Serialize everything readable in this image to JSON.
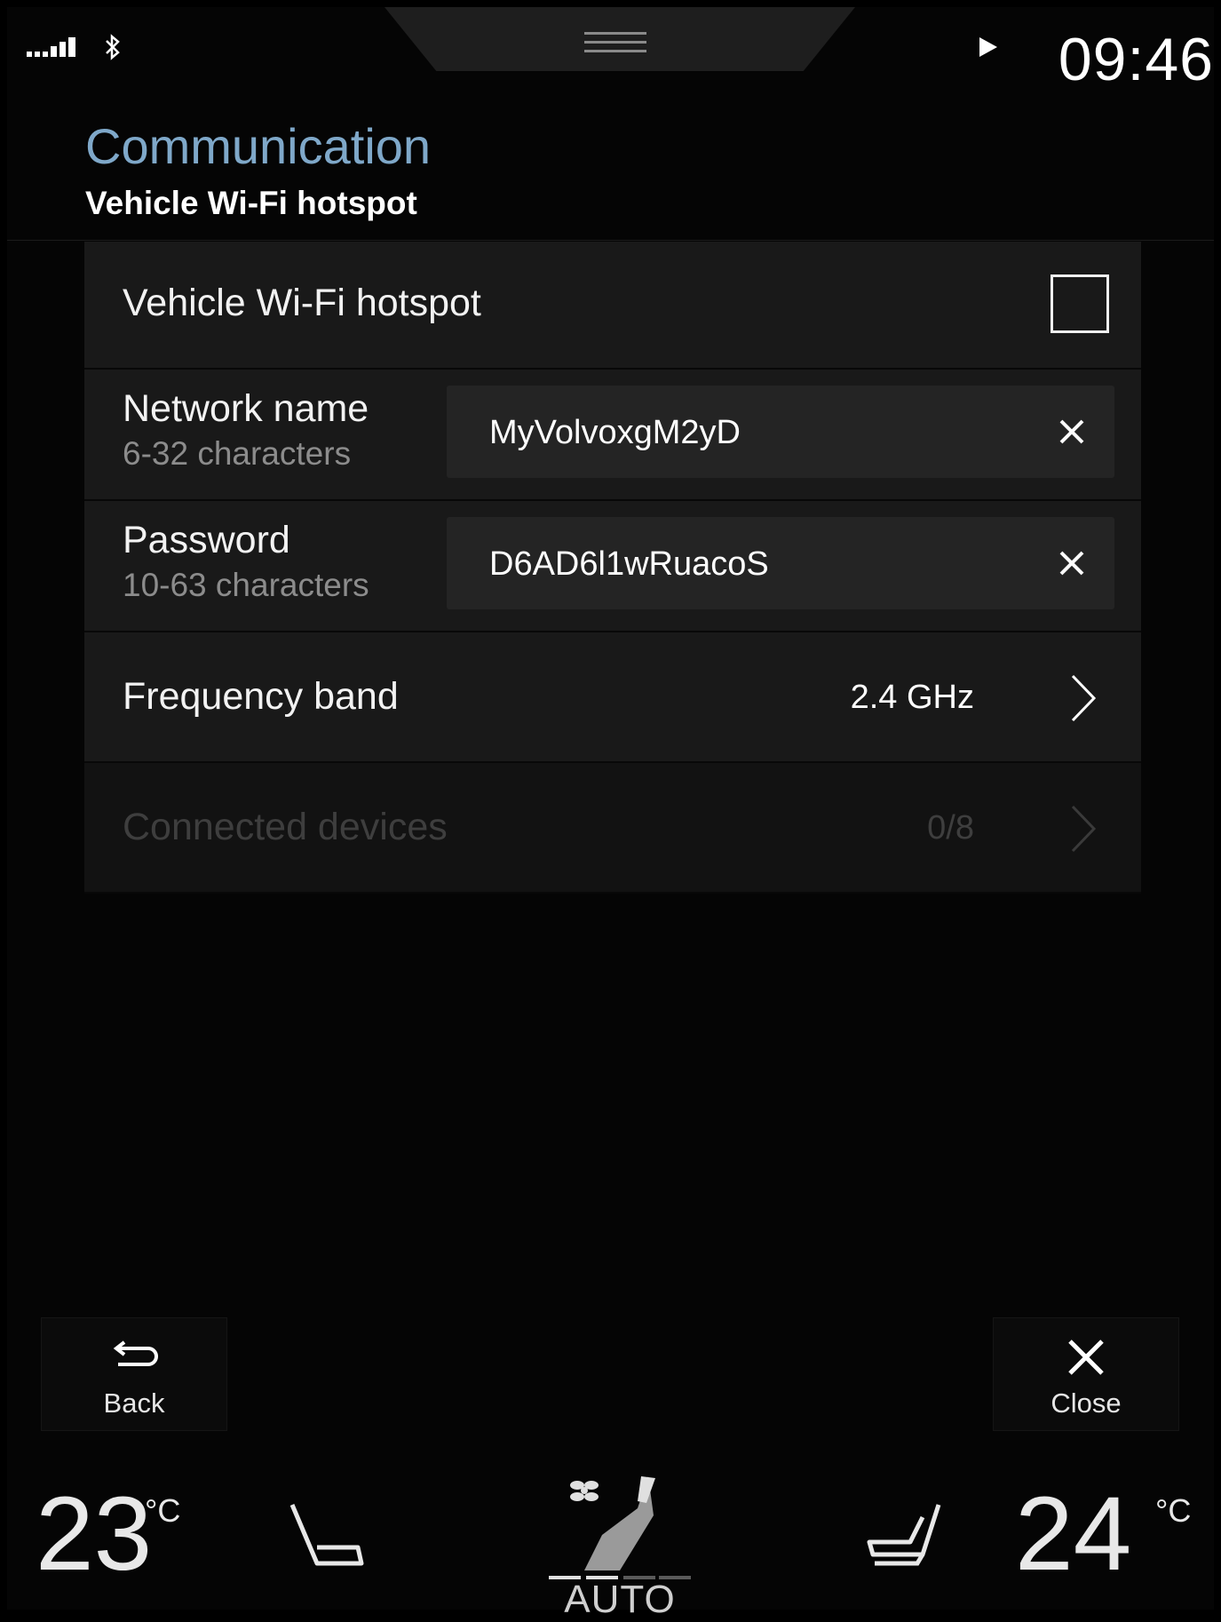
{
  "status_bar": {
    "signal_icon": "signal-strength-icon",
    "bluetooth_icon": "bluetooth-icon",
    "media_icon": "play-icon",
    "time": "09:46"
  },
  "header": {
    "title": "Communication",
    "subtitle": "Vehicle Wi-Fi hotspot",
    "title_color": "#7fa8c9"
  },
  "settings": {
    "hotspot_toggle": {
      "label": "Vehicle Wi-Fi hotspot",
      "checked": false
    },
    "network_name": {
      "label": "Network name",
      "hint": "6-32 characters",
      "value": "MyVolvoxgM2yD",
      "clear_icon": "close-icon"
    },
    "password": {
      "label": "Password",
      "hint": "10-63 characters",
      "value": "D6AD6l1wRuacoS",
      "clear_icon": "close-icon"
    },
    "frequency_band": {
      "label": "Frequency band",
      "value": "2.4 GHz",
      "icon": "chevron-right-icon"
    },
    "connected_devices": {
      "label": "Connected devices",
      "value": "0/8",
      "disabled": true,
      "icon": "chevron-right-icon"
    }
  },
  "nav": {
    "back_label": "Back",
    "back_icon": "back-arrow-icon",
    "close_label": "Close",
    "close_icon": "close-icon"
  },
  "climate": {
    "driver_temp": "23",
    "passenger_temp": "24",
    "unit": "°C",
    "mode_label": "AUTO",
    "driver_seat_icon": "seat-icon",
    "passenger_seat_icon": "seat-icon",
    "fan_icon": "fan-airflow-icon"
  }
}
